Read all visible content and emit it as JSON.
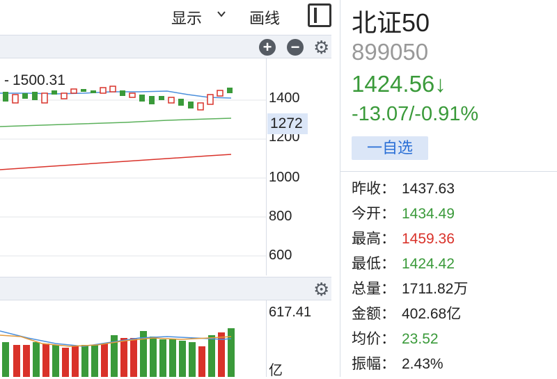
{
  "toolbar": {
    "display_label": "显示",
    "drawline_label": "画线"
  },
  "main_chart": {
    "high_marker": "1500.31",
    "y_ticks": [
      "1400",
      "1200",
      "1000",
      "800",
      "600"
    ],
    "current_price": "1272"
  },
  "volume_chart": {
    "max_label": "617.41",
    "unit_label": "亿"
  },
  "stock": {
    "name": "北证50",
    "code": "899050",
    "price": "1424.56↓",
    "change": "-13.07/-0.91%",
    "fav_label": "一自选"
  },
  "stats": [
    {
      "label": "昨收：",
      "value": "1437.63",
      "color": "neutral"
    },
    {
      "label": "今开：",
      "value": "1434.49",
      "color": "green"
    },
    {
      "label": "最高：",
      "value": "1459.36",
      "color": "red"
    },
    {
      "label": "最低：",
      "value": "1424.42",
      "color": "green"
    },
    {
      "label": "总量：",
      "value": "1711.82万",
      "color": "neutral"
    },
    {
      "label": "金额：",
      "value": "402.68亿",
      "color": "neutral"
    },
    {
      "label": "均价：",
      "value": "23.52",
      "color": "green"
    },
    {
      "label": "振幅：",
      "value": "2.43%",
      "color": "neutral"
    }
  ],
  "colors": {
    "up": "#d9322a",
    "down": "#3a9a3a",
    "accent": "#2a6fd6"
  }
}
